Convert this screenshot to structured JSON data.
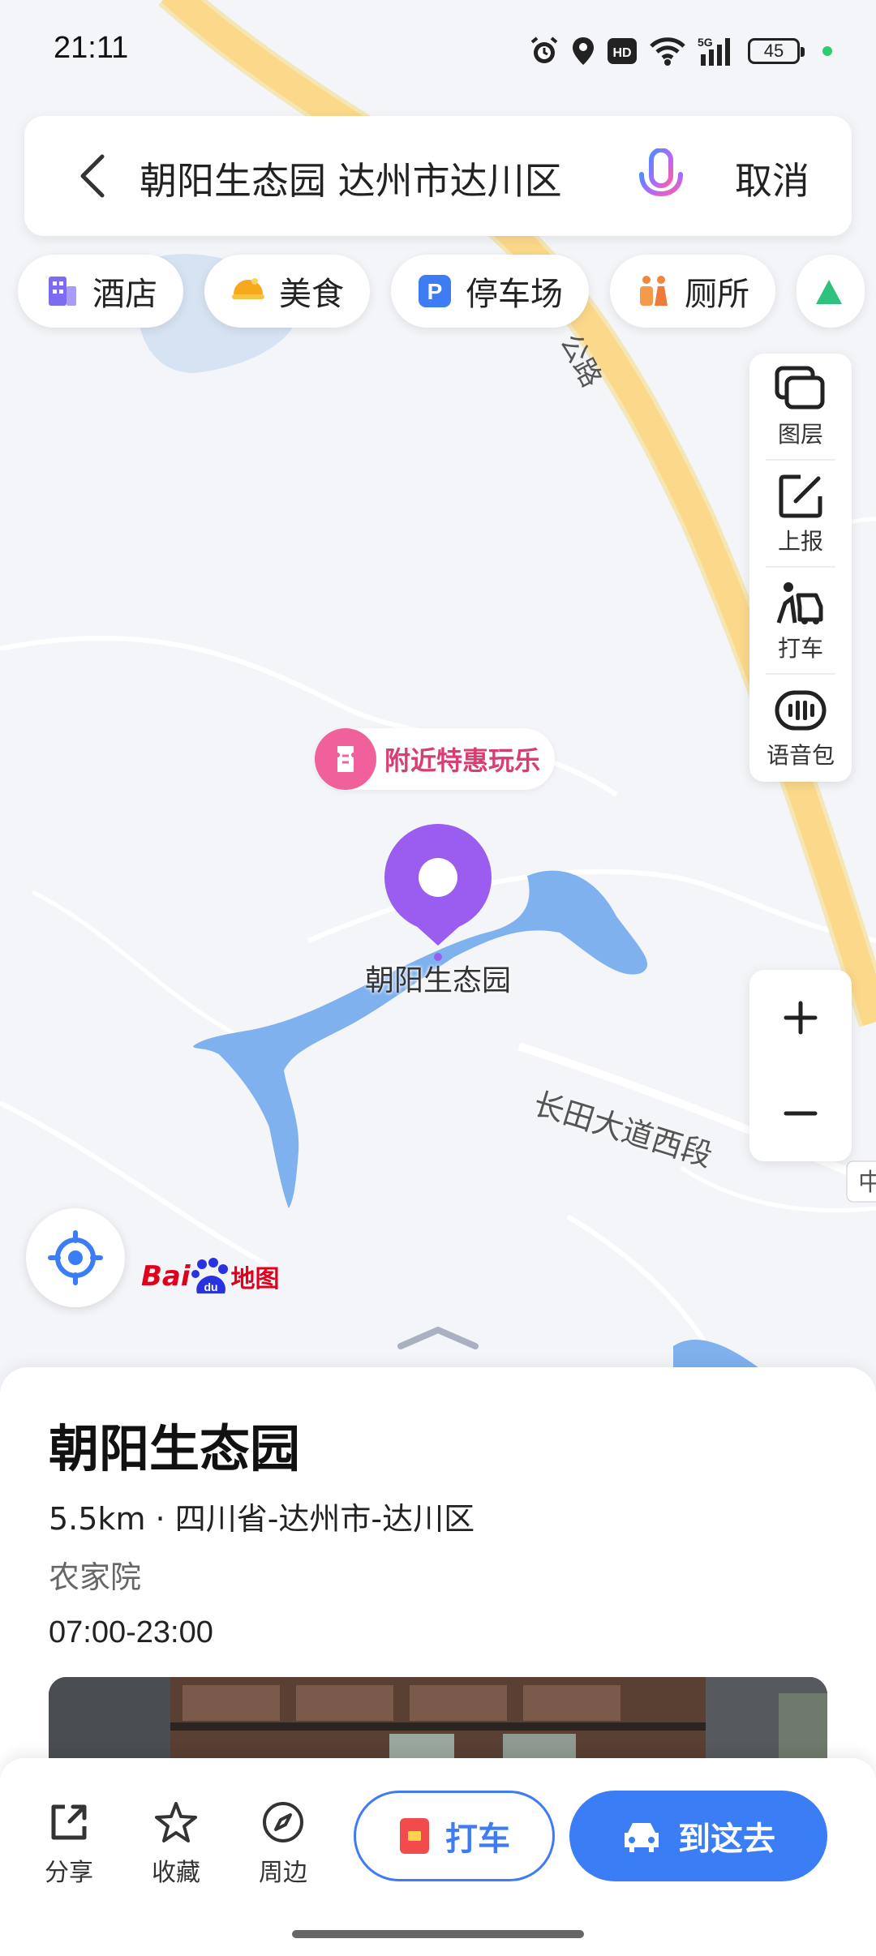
{
  "status_bar": {
    "time": "21:11",
    "battery": "45",
    "network": "5G",
    "hd": "HD"
  },
  "search": {
    "query": "朝阳生态园 达州市达川区",
    "cancel_label": "取消"
  },
  "categories": [
    {
      "label": "酒店",
      "icon": "hotel-icon"
    },
    {
      "label": "美食",
      "icon": "food-icon"
    },
    {
      "label": "停车场",
      "icon": "parking-icon"
    },
    {
      "label": "厕所",
      "icon": "toilet-icon"
    }
  ],
  "map_tools": {
    "layers": "图层",
    "report": "上报",
    "taxi": "打车",
    "voice": "语音包"
  },
  "map": {
    "promo": "附近特惠玩乐",
    "poi_name": "朝阳生态园",
    "road_name": "长田大道西段",
    "road_name_2": "公路",
    "edge_label": "中",
    "logo_bai": "Bai",
    "logo_du": "du",
    "logo_text": "地图",
    "colors": {
      "water": "#7fb1ee",
      "road": "#fbd88a",
      "pin": "#9b5cf0"
    }
  },
  "place": {
    "name": "朝阳生态园",
    "distance_address": "5.5km · 四川省-达州市-达川区",
    "category": "农家院",
    "hours": "07:00-23:00"
  },
  "actions": {
    "share": "分享",
    "favorite": "收藏",
    "nearby": "周边",
    "taxi": "打车",
    "navigate": "到这去",
    "accent_color": "#3a7df5"
  }
}
